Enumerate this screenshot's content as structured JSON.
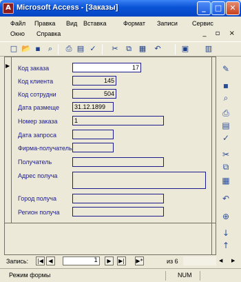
{
  "window": {
    "title": "Microsoft Access - [Заказы]",
    "app_icon": "access-icon",
    "minimize_glyph": "_",
    "maximize_glyph": "□",
    "close_glyph": "✕"
  },
  "menu": {
    "row1": [
      "Файл",
      "Правка",
      "Вид",
      "Вставка",
      "Формат",
      "Записи",
      "Сервис"
    ],
    "row2": [
      "Окно",
      "Справка"
    ],
    "mdi_controls": "_ ▫ ×"
  },
  "toolbar": {
    "icons": [
      "new-icon",
      "open-icon",
      "save-icon",
      "search-file-icon",
      "print-icon",
      "print-preview-icon",
      "spelling-icon",
      "cut-icon",
      "copy-icon",
      "paste-icon",
      "undo-icon",
      "view-icon",
      "properties-icon"
    ]
  },
  "form": {
    "fields": [
      {
        "label": "Код заказа",
        "value": "17"
      },
      {
        "label": "Код клиента",
        "value": "145"
      },
      {
        "label": "Код сотрудни",
        "value": "504"
      },
      {
        "label": "Дата размеще",
        "value": "31.12.1899"
      },
      {
        "label": "Номер заказа",
        "value": "1"
      },
      {
        "label": "Дата запроса",
        "value": ""
      },
      {
        "label": "Фирма-получатель",
        "value": ""
      },
      {
        "label": "Получатель",
        "value": ""
      },
      {
        "label": "Адрес получа",
        "value": ""
      },
      {
        "label": "Город получа",
        "value": ""
      },
      {
        "label": "Регион получа",
        "value": ""
      }
    ],
    "record_selector_glyph": "▶"
  },
  "toolbox": {
    "icons": [
      "design-view-icon",
      "save-icon",
      "search-icon",
      "print-icon",
      "find-icon",
      "spelling-icon",
      "cut-icon",
      "copy-icon",
      "paste-icon",
      "undo-icon",
      "hyperlink-icon",
      "sort-ascending-icon",
      "sort-descending-icon"
    ]
  },
  "navigation": {
    "label": "Запись:",
    "current_record": "1",
    "of_text": "из 6",
    "first_glyph": "|◀",
    "prev_glyph": "◀",
    "next_glyph": "▶",
    "last_glyph": "▶|",
    "new_glyph": "▶*"
  },
  "status": {
    "mode": "Режим формы",
    "num": "NUM"
  }
}
